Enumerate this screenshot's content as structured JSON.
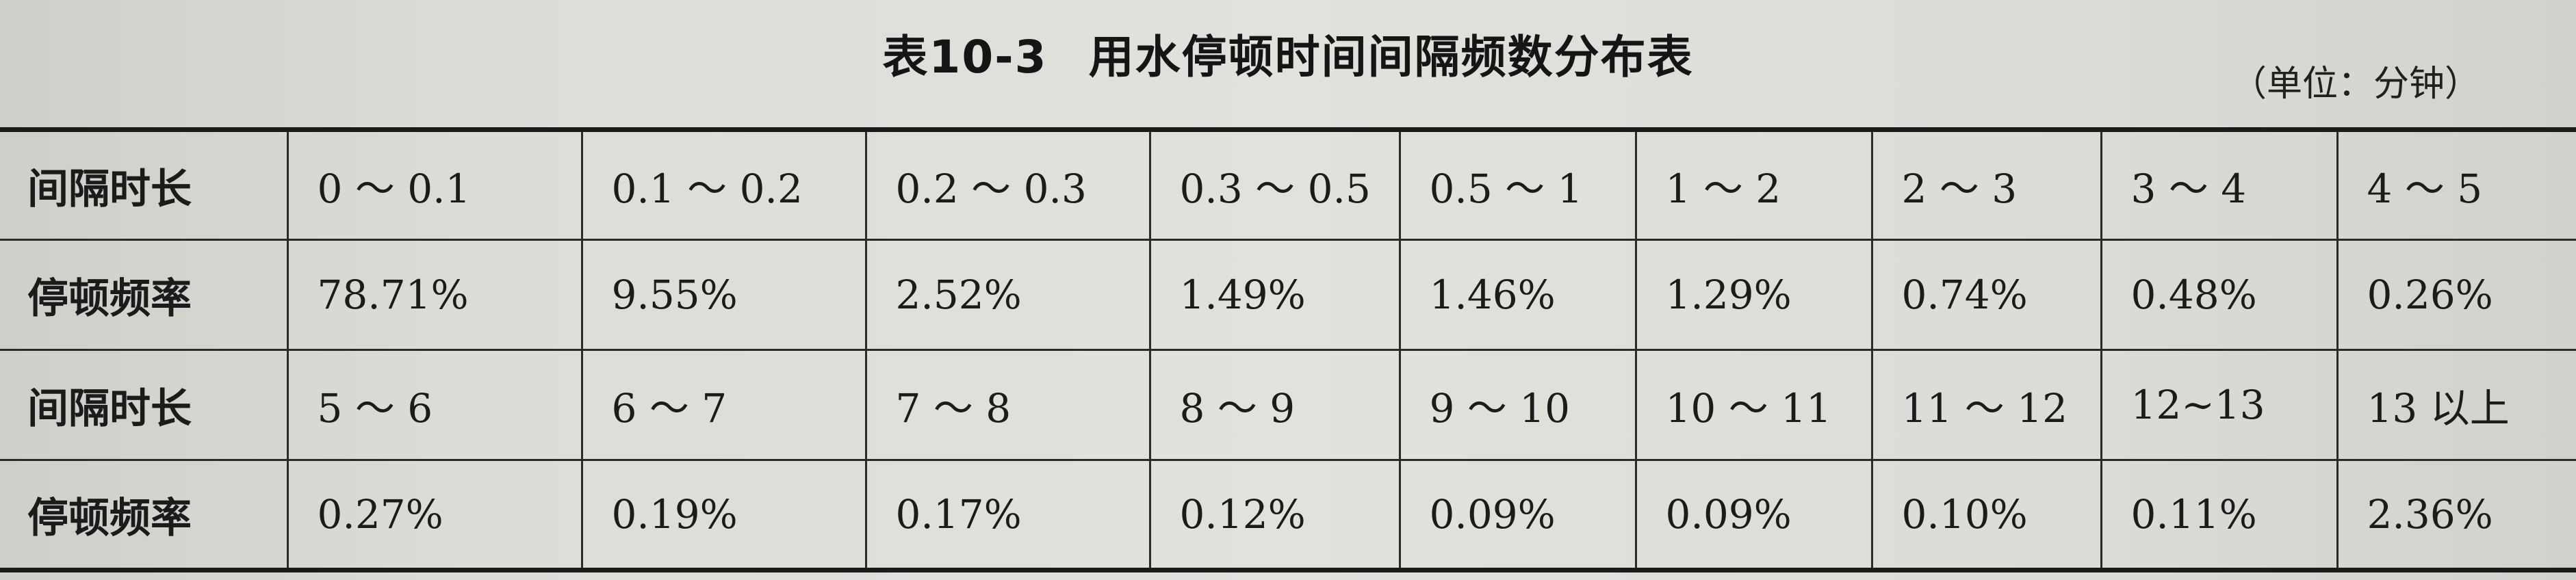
{
  "title": {
    "number": "表10-3",
    "text": "用水停顿时间间隔频数分布表"
  },
  "unit": "（单位：分钟）",
  "table": {
    "rows": [
      {
        "header": "间隔时长",
        "cells": [
          "0 ～ 0.1",
          "0.1 ～ 0.2",
          "0.2 ～ 0.3",
          "0.3 ～ 0.5",
          "0.5 ～ 1",
          "1 ～ 2",
          "2 ～ 3",
          "3 ～ 4",
          "4 ～ 5"
        ]
      },
      {
        "header": "停顿频率",
        "cells": [
          "78.71%",
          "9.55%",
          "2.52%",
          "1.49%",
          "1.46%",
          "1.29%",
          "0.74%",
          "0.48%",
          "0.26%"
        ]
      },
      {
        "header": "间隔时长",
        "cells": [
          "5 ～ 6",
          "6 ～ 7",
          "7 ～ 8",
          "8 ～ 9",
          "9 ～ 10",
          "10 ～ 11",
          "11 ～ 12",
          "12~13",
          "13 以上"
        ]
      },
      {
        "header": "停顿频率",
        "cells": [
          "0.27%",
          "0.19%",
          "0.17%",
          "0.12%",
          "0.09%",
          "0.09%",
          "0.10%",
          "0.11%",
          "2.36%"
        ]
      }
    ]
  }
}
